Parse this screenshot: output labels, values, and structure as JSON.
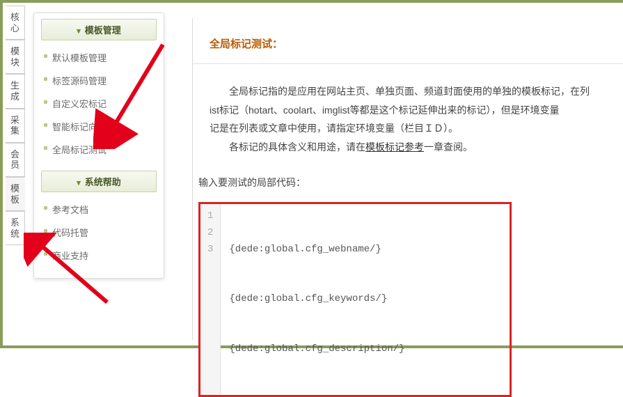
{
  "vnav": [
    {
      "label": "核心"
    },
    {
      "label": "模块"
    },
    {
      "label": "生成"
    },
    {
      "label": "采集"
    },
    {
      "label": "会员"
    },
    {
      "label": "模板",
      "active": true
    },
    {
      "label": "系统"
    }
  ],
  "sidebar": {
    "groups": [
      {
        "title": "模板管理",
        "items": [
          "默认模板管理",
          "标签源码管理",
          "自定义宏标记",
          "智能标记向导",
          "全局标记测试"
        ]
      },
      {
        "title": "系统帮助",
        "items": [
          "参考文档",
          "代码托管",
          "商业支持"
        ]
      }
    ]
  },
  "main": {
    "title": "全局标记测试：",
    "desc_line1_prefix": "全局标记指的是应用在网站主页、单独页面、频道封面使用的单独的模板标记，在列",
    "desc_line2": "ist标记（hotart、coolart、imglist等都是这个标记延伸出来的标记），但是环境变量",
    "desc_line3": "记是在列表或文章中使用，请指定环境变量（栏目ＩＤ）。",
    "desc_line4_prefix": "各标记的具体含义和用途，请在",
    "desc_link": "模板标记参考",
    "desc_line4_suffix": "一章查阅。",
    "input_label": "输入要测试的局部代码：",
    "code": {
      "gutter": [
        "1",
        "2",
        "3"
      ],
      "lines": [
        "{dede:global.cfg_webname/}",
        "{dede:global.cfg_keywords/}",
        "{dede:global.cfg_description/}"
      ]
    }
  },
  "colors": {
    "accent": "#8a9c5a",
    "title": "#b85c00",
    "arrow": "#e2001a"
  }
}
